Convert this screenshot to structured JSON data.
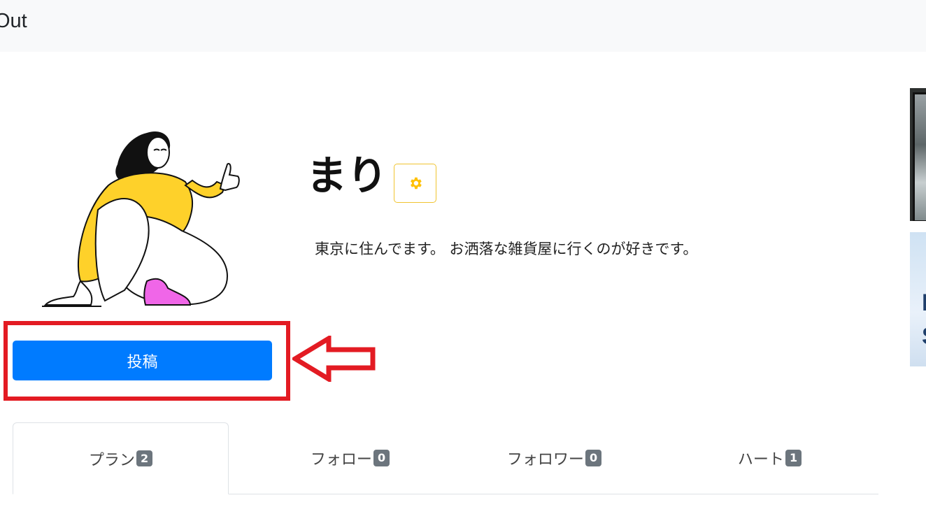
{
  "navbar": {
    "text": "Out"
  },
  "profile": {
    "name": "まり",
    "bio": "東京に住んでます。 お洒落な雑貨屋に行くのが好きです。"
  },
  "actions": {
    "post_label": "投稿"
  },
  "tabs": [
    {
      "label": "プラン",
      "count": "2"
    },
    {
      "label": "フォロー",
      "count": "0"
    },
    {
      "label": "フォロワー",
      "count": "0"
    },
    {
      "label": "ハート",
      "count": "1"
    }
  ],
  "side_images": {
    "bottom_letters": [
      "I",
      "S"
    ]
  },
  "colors": {
    "primary": "#007bff",
    "highlight": "#e31b23",
    "warning": "#ffc107",
    "badge": "#6c757d"
  },
  "icons": {
    "settings": "gear-icon",
    "annotation": "arrow-left-icon"
  }
}
